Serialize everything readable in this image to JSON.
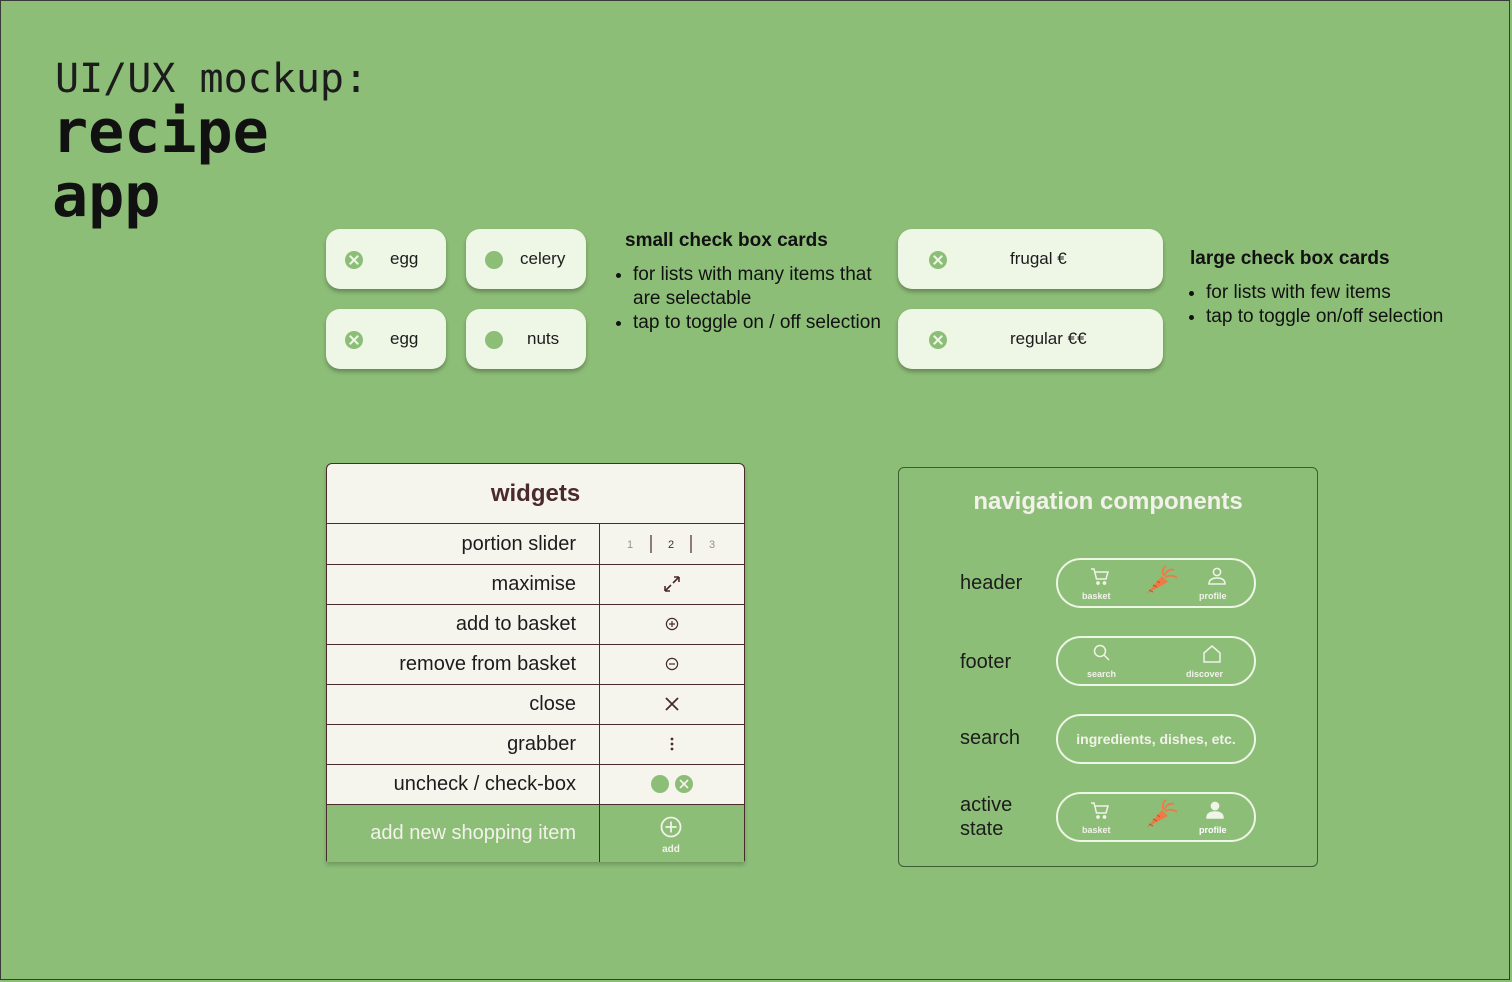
{
  "title": {
    "line1": "UI/UX mockup:",
    "line2": "recipe",
    "line3": "app"
  },
  "small_cards": [
    {
      "label": "egg",
      "state": "checked"
    },
    {
      "label": "celery",
      "state": "unchecked"
    },
    {
      "label": "egg",
      "state": "checked"
    },
    {
      "label": "nuts",
      "state": "unchecked"
    }
  ],
  "small_notes": {
    "heading": "small check box cards",
    "bullets": [
      "for lists with many items that are selectable",
      "tap to toggle on / off selection"
    ]
  },
  "large_cards": [
    {
      "label": "frugal €",
      "state": "checked"
    },
    {
      "label": "regular €€",
      "state": "checked"
    }
  ],
  "large_notes": {
    "heading": "large check box cards",
    "bullets": [
      "for lists with few items",
      "tap to toggle on/off selection"
    ]
  },
  "widgets": {
    "title": "widgets",
    "rows": [
      {
        "label": "portion slider",
        "icon": "portion-slider"
      },
      {
        "label": "maximise",
        "icon": "maximise-icon"
      },
      {
        "label": "add to basket",
        "icon": "plus-circle-icon"
      },
      {
        "label": "remove from basket",
        "icon": "minus-circle-icon"
      },
      {
        "label": "close",
        "icon": "close-icon"
      },
      {
        "label": "grabber",
        "icon": "grabber-icon"
      },
      {
        "label": "uncheck / check-box",
        "icon": "checkbox-icons"
      }
    ],
    "slider_ticks": [
      "1",
      "2",
      "3"
    ],
    "add_row": {
      "label": "add new shopping item",
      "button_label": "add"
    }
  },
  "navigation": {
    "title": "navigation components",
    "header_label": "header",
    "footer_label": "footer",
    "search_label": "search",
    "active_label_1": "active",
    "active_label_2": "state",
    "basket": "basket",
    "profile": "profile",
    "search": "search",
    "discover": "discover",
    "search_placeholder": "ingredients, dishes, etc."
  },
  "colors": {
    "background": "#8dbe78",
    "card": "#eef6e6",
    "accent_dark": "#4a2a2a",
    "carrot": "#f07a45"
  }
}
